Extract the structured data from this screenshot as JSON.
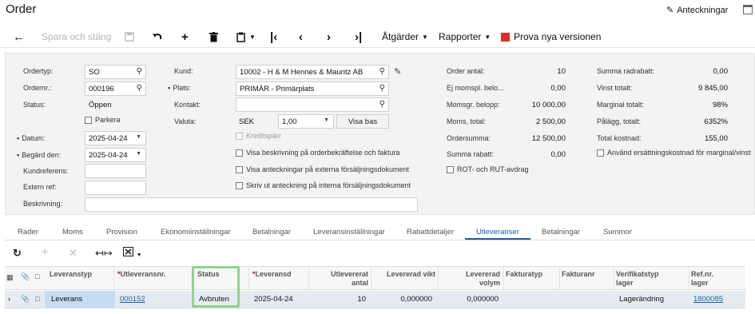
{
  "header": {
    "title": "Order",
    "notes_label": "Anteckningar"
  },
  "toolbar": {
    "back_icon": "back-arrow-icon",
    "save_close_label": "Spara och stäng",
    "save_icon": "save-icon",
    "undo_icon": "undo-icon",
    "add_icon": "plus-icon",
    "delete_icon": "trash-icon",
    "copy_icon": "copy-paste-icon",
    "first_icon": "first-record-icon",
    "prev_icon": "previous-record-icon",
    "next_icon": "next-record-icon",
    "last_icon": "last-record-icon",
    "actions_label": "Åtgärder",
    "reports_label": "Rapporter",
    "new_versions_label": "Prova nya versionen"
  },
  "form": {
    "ordertype": {
      "label": "Ordertyp:",
      "value": "SO"
    },
    "ordernr": {
      "label": "Ordernr.:",
      "value": "000196"
    },
    "status": {
      "label": "Status:",
      "value": "Öppen"
    },
    "parkera": {
      "label": "Parkera"
    },
    "datum": {
      "label": "Datum:",
      "value": "2025-04-24"
    },
    "begard": {
      "label": "Begärd den:",
      "value": "2025-04-24"
    },
    "kundreferens": {
      "label": "Kundreferens:",
      "value": ""
    },
    "externref": {
      "label": "Extern ref:",
      "value": ""
    },
    "beskrivning": {
      "label": "Beskrivning:",
      "value": ""
    },
    "kund": {
      "label": "Kund:",
      "value": "10002 - H & M Hennes & Mauritz AB"
    },
    "plats": {
      "label": "Plats:",
      "value": "PRIMÄR - Primärplats"
    },
    "kontakt": {
      "label": "Kontakt:",
      "value": ""
    },
    "valuta": {
      "label": "Valuta:",
      "currency": "SEK",
      "rate": "1,00",
      "button": "Visa bas"
    },
    "kreditsparr": {
      "label": "Kreditspärr"
    },
    "visa_beskrivning": {
      "label": "Visa beskrivning på orderbekräftelse och faktura"
    },
    "visa_anteckningar": {
      "label": "Visa anteckningar på externa försäljningsdokument"
    },
    "skriv_ut": {
      "label": "Skriv ut anteckning på interna försäljningsdokument"
    },
    "order_antal": {
      "label": "Order antal:",
      "value": "10"
    },
    "ej_momspl": {
      "label": "Ej momspl. belo...",
      "value": "0,00"
    },
    "momsgr": {
      "label": "Momsgr. belopp:",
      "value": "10 000,00"
    },
    "moms_total": {
      "label": "Moms, total:",
      "value": "2 500,00"
    },
    "ordersumma": {
      "label": "Ordersumma:",
      "value": "12 500,00"
    },
    "summa_rabatt": {
      "label": "Summa rabatt:",
      "value": "0,00"
    },
    "rot_rut": {
      "label": "ROT- och RUT-avdrag"
    },
    "summa_radrabatt": {
      "label": "Summa radrabatt:",
      "value": "0,00"
    },
    "vinst_totalt": {
      "label": "Vinst totalt:",
      "value": "9 845,00"
    },
    "marginal_totalt": {
      "label": "Marginal totalt:",
      "value": "98%"
    },
    "palagg_totalt": {
      "label": "Pålägg, totalt:",
      "value": "6352%"
    },
    "total_kostnad": {
      "label": "Total kostnad:",
      "value": "155,00"
    },
    "anvand_ersattning": {
      "label": "Använd ersättningskostnad för marginal/vinst"
    }
  },
  "tabs": [
    "Rader",
    "Moms",
    "Provision",
    "Ekonomiinställningar",
    "Betalningar",
    "Leveransinställningar",
    "Rabattdetaljer",
    "Utleveranser",
    "Betalningar",
    "Summor"
  ],
  "active_tab": "Utleveranser",
  "grid": {
    "headers": {
      "leveranstyp": "Leveranstyp",
      "utleveransnr": "Utleveransnr.",
      "status": "Status",
      "leveransd": "Leveransd",
      "utlevererat_antal_1": "Utlevererat",
      "utlevererat_antal_2": "antal",
      "levererad_vikt": "Levererad vikt",
      "levererad_volym_1": "Levererad",
      "levererad_volym_2": "volym",
      "fakturatyp": "Fakturatyp",
      "fakturanr": "Fakturanr",
      "verifikatstyp_1": "Verifikatstyp",
      "verifikatstyp_2": "lager",
      "refnr_1": "Ref.nr.",
      "refnr_2": "lager"
    },
    "rows": [
      {
        "leveranstyp": "Leverans",
        "utleveransnr": "000152",
        "status": "Avbruten",
        "leveransd": "2025-04-24",
        "antal": "10",
        "vikt": "0,000000",
        "volym": "0,000000",
        "fakturatyp": "",
        "fakturanr": "",
        "verifikatstyp": "Lagerändring",
        "refnr": "1800085"
      }
    ]
  },
  "colors": {
    "accent": "#1a5fa8",
    "highlight": "#8fd48a",
    "red_icon": "#d9302c"
  }
}
